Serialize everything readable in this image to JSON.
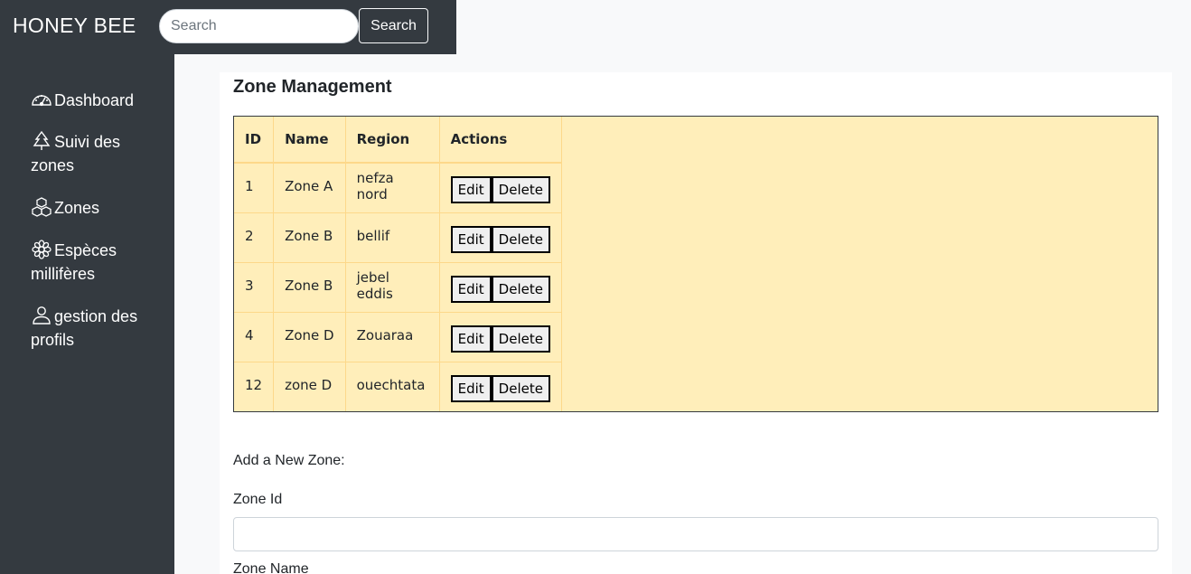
{
  "header": {
    "brand": "HONEY BEE",
    "search_placeholder": "Search",
    "search_button": "Search"
  },
  "sidebar": {
    "items": [
      {
        "label": "Dashboard",
        "icon": "speedometer-icon"
      },
      {
        "label": "Suivi des zones",
        "icon": "tree-icon"
      },
      {
        "label": "Zones",
        "icon": "boxes-icon"
      },
      {
        "label": "Espèces millifères",
        "icon": "flower-icon"
      },
      {
        "label": "gestion des profils",
        "icon": "person-icon"
      }
    ]
  },
  "main": {
    "title": "Zone Management",
    "table": {
      "headers": [
        "ID",
        "Name",
        "Region",
        "Actions"
      ],
      "rows": [
        {
          "id": "1",
          "name": "Zone A",
          "region": "nefza nord"
        },
        {
          "id": "2",
          "name": "Zone B",
          "region": "bellif"
        },
        {
          "id": "3",
          "name": "Zone B",
          "region": "jebel eddis"
        },
        {
          "id": "4",
          "name": "Zone D",
          "region": "Zouaraa"
        },
        {
          "id": "12",
          "name": "zone D",
          "region": "ouechtata"
        }
      ],
      "edit_label": "Edit",
      "delete_label": "Delete"
    },
    "form": {
      "heading": "Add a New Zone:",
      "zone_id_label": "Zone Id",
      "zone_id_value": "",
      "zone_name_label": "Zone Name"
    }
  },
  "colors": {
    "sidebar_bg": "#343a40",
    "table_bg": "#ffeeba",
    "page_bg": "#f8f9fa"
  }
}
